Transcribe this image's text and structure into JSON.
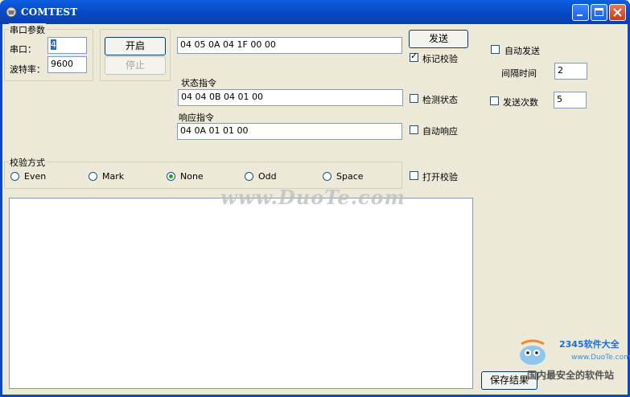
{
  "window": {
    "title": "COMTEST"
  },
  "serial_group": {
    "label": "串口参数",
    "port_label": "串口：",
    "port_value": "4",
    "baud_label": "波特率：",
    "baud_value": "9600"
  },
  "control": {
    "open_label": "开启",
    "stop_label": "停止"
  },
  "send": {
    "command_value": "04 05 0A 04 1F 00 00",
    "send_label": "发送",
    "mark_check_label": "标记校验"
  },
  "status": {
    "label": "状态指令",
    "value": "04 04 0B 04 01 00",
    "check_label": "检测状态"
  },
  "response": {
    "label": "响应指令",
    "value": "04 0A 01 01 00",
    "check_label": "自动响应"
  },
  "auto": {
    "auto_send_label": "自动发送",
    "interval_label": "间隔时间",
    "interval_value": "2",
    "count_label": "发送次数",
    "count_value": "5"
  },
  "parity": {
    "label": "校验方式",
    "options": [
      "Even",
      "Mark",
      "None",
      "Odd",
      "Space"
    ],
    "selected": "None",
    "open_check_label": "打开校验"
  },
  "save_label": "保存结果",
  "watermarks": {
    "main": "www.DuoTe.com",
    "brand": "2345软件大全",
    "url": "www.DuoTe.com",
    "tagline": "国内最安全的软件站"
  },
  "icons": {
    "title": "app-icon",
    "minimize": "minimize-icon",
    "maximize": "maximize-icon",
    "close": "close-icon"
  }
}
